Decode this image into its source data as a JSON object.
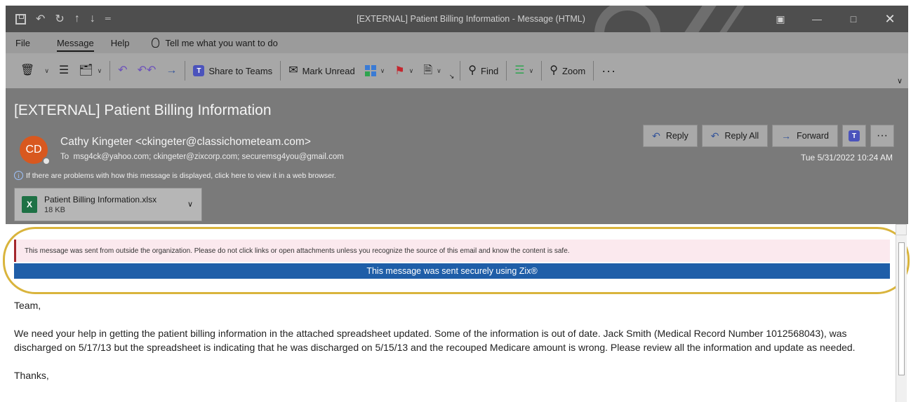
{
  "window": {
    "title": "[EXTERNAL] Patient Billing Information  -  Message (HTML)"
  },
  "menu": {
    "file": "File",
    "message": "Message",
    "help": "Help",
    "tell_me": "Tell me what you want to do"
  },
  "toolbar": {
    "share_to_teams": "Share to Teams",
    "mark_unread": "Mark Unread",
    "find": "Find",
    "zoom": "Zoom",
    "more": "···"
  },
  "header": {
    "subject": "[EXTERNAL] Patient Billing Information",
    "avatar_initials": "CD",
    "sender": "Cathy Kingeter <ckingeter@classichometeam.com>",
    "to_label": "To",
    "recipients": "msg4ck@yahoo.com; ckingeter@zixcorp.com; securemsg4you@gmail.com",
    "info_text": "If there are problems with how this message is displayed, click here to view it in a web browser.",
    "datetime": "Tue 5/31/2022 10:24 AM",
    "reply": "Reply",
    "reply_all": "Reply All",
    "forward": "Forward",
    "more": "···"
  },
  "attachment": {
    "name": "Patient Billing Information.xlsx",
    "size": "18 KB",
    "type_icon": "X"
  },
  "body": {
    "external_warning": "This message was sent from outside the organization. Please do not click links or open attachments unless you recognize the source of this email and know the content is safe.",
    "zix_banner": "This message was sent securely using Zix®",
    "greeting": "Team,",
    "paragraph": "We need your help in getting the patient billing information in the attached spreadsheet updated. Some of the information is out of date. Jack Smith (Medical Record Number 1012568043), was discharged on 5/17/13 but the spreadsheet is indicating that he was discharged on 5/15/13 and the recouped Medicare amount is wrong. Please review all the information and update as needed.",
    "closing": "Thanks,"
  },
  "colors": {
    "titlebar": "#4e4e4e",
    "header_bg": "#7a7a7a",
    "zix_blue": "#1f5ea8",
    "warning_pink": "#fbe9ee",
    "warning_border": "#a4262c",
    "highlight_ring": "#d9b43c",
    "avatar": "#d8581f"
  }
}
